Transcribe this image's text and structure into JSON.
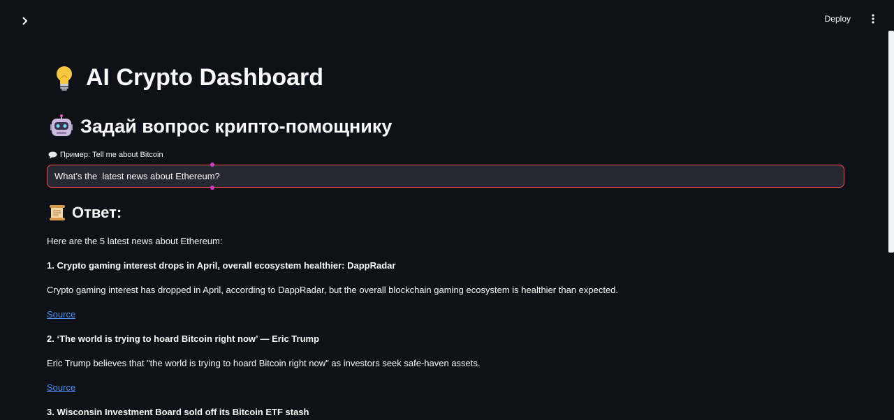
{
  "header": {
    "deploy_label": "Deploy"
  },
  "page": {
    "title": "AI Crypto Dashboard",
    "subtitle": "Задай вопрос крипто-помощнику"
  },
  "query": {
    "label": "Пример: Tell me about Bitcoin",
    "value": "What’s the  latest news about Ethereum?"
  },
  "answer": {
    "heading": "Ответ:",
    "intro": "Here are the 5 latest news about Ethereum:",
    "items": [
      {
        "title": "1. Crypto gaming interest drops in April, overall ecosystem healthier: DappRadar",
        "summary": "Crypto gaming interest has dropped in April, according to DappRadar, but the overall blockchain gaming ecosystem is healthier than expected.",
        "link": "Source"
      },
      {
        "title": "2. ‘The world is trying to hoard Bitcoin right now’ — Eric Trump",
        "summary": "Eric Trump believes that \"the world is trying to hoard Bitcoin right now\" as investors seek safe-haven assets.",
        "link": "Source"
      },
      {
        "title": "3. Wisconsin Investment Board sold off its Bitcoin ETF stash"
      }
    ]
  },
  "icons": {
    "sidebar_toggle": "chevron-right-icon",
    "menu": "vertical-dots-icon",
    "title": "light-bulb-icon",
    "subtitle": "robot-face-icon",
    "label": "speech-bubble-icon",
    "answer": "scroll-icon"
  },
  "colors": {
    "background": "#0e1117",
    "input_border": "#ff4b4b",
    "input_background": "#262730",
    "link": "#4b90f0"
  }
}
